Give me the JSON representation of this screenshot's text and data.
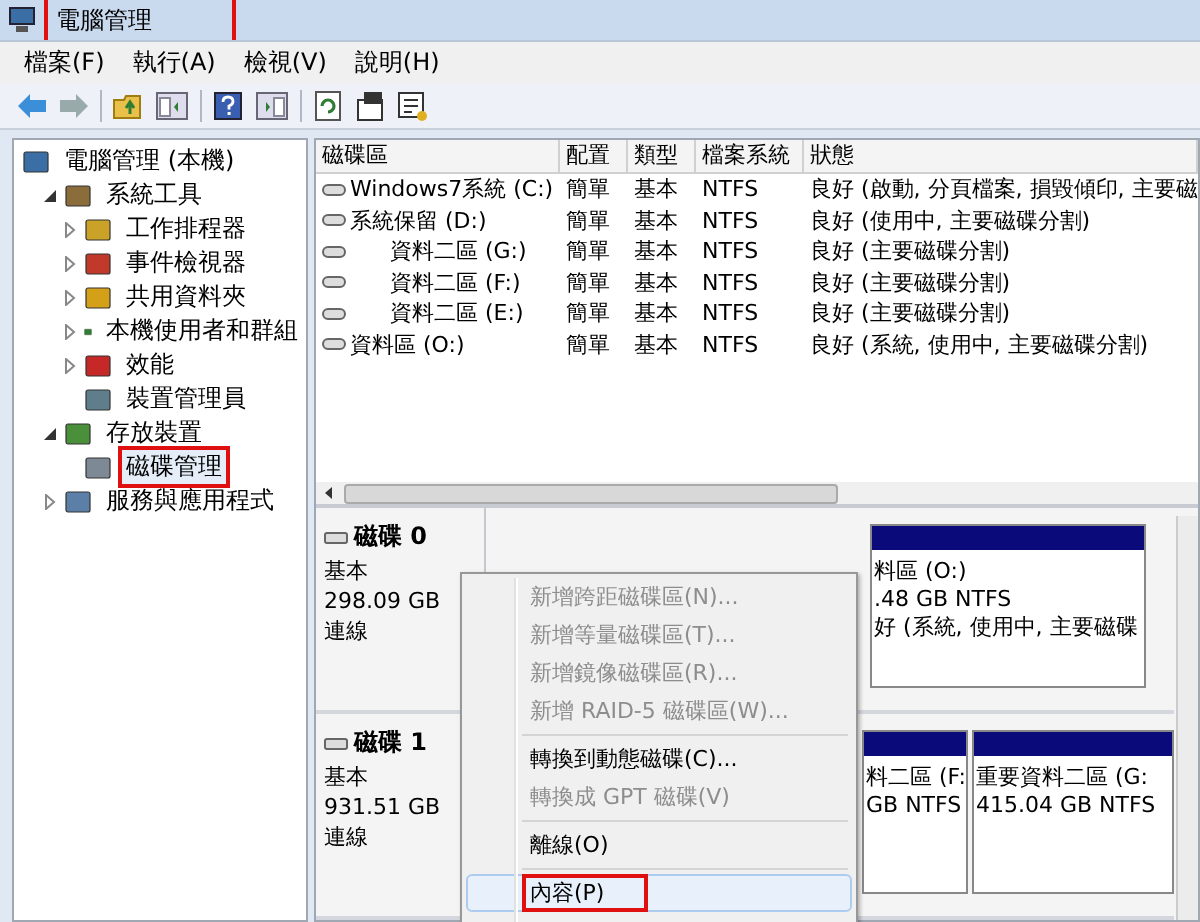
{
  "window": {
    "title": "電腦管理",
    "highlighted": true
  },
  "menu_bar": [
    "檔案(F)",
    "執行(A)",
    "檢視(V)",
    "說明(H)"
  ],
  "tree": [
    {
      "label": "電腦管理 (本機)",
      "highlighted": false,
      "children": [
        {
          "label": "系統工具",
          "expanded": true,
          "highlighted": false,
          "children": [
            {
              "label": "工作排程器",
              "expanded": false,
              "highlighted": false
            },
            {
              "label": "事件檢視器",
              "expanded": false,
              "highlighted": false
            },
            {
              "label": "共用資料夾",
              "expanded": false,
              "highlighted": false
            },
            {
              "label": "本機使用者和群組",
              "expanded": false,
              "highlighted": false
            },
            {
              "label": "效能",
              "expanded": false,
              "highlighted": false
            },
            {
              "label": "裝置管理員",
              "highlighted": false
            }
          ]
        },
        {
          "label": "存放裝置",
          "expanded": true,
          "highlighted": false,
          "children": [
            {
              "label": "磁碟管理",
              "highlighted": true,
              "selected": true
            }
          ]
        },
        {
          "label": "服務與應用程式",
          "expanded": false,
          "highlighted": false
        }
      ]
    }
  ],
  "volume_table": {
    "columns": [
      "磁碟區",
      "配置",
      "類型",
      "檔案系統",
      "狀態"
    ],
    "rows": [
      {
        "kind": "primary",
        "cells": [
          "Windows7系統 (C:)",
          "簡單",
          "基本",
          "NTFS",
          "良好 (啟動, 分頁檔案, 損毀傾印, 主要磁"
        ]
      },
      {
        "kind": "primary",
        "cells": [
          "系統保留 (D:)",
          "簡單",
          "基本",
          "NTFS",
          "良好 (使用中, 主要磁碟分割)"
        ]
      },
      {
        "kind": "logical",
        "cells": [
          "資料二區 (G:)",
          "簡單",
          "基本",
          "NTFS",
          "良好 (主要磁碟分割)"
        ]
      },
      {
        "kind": "logical",
        "cells": [
          "資料二區 (F:)",
          "簡單",
          "基本",
          "NTFS",
          "良好 (主要磁碟分割)"
        ]
      },
      {
        "kind": "logical",
        "cells": [
          "資料二區 (E:)",
          "簡單",
          "基本",
          "NTFS",
          "良好 (主要磁碟分割)"
        ]
      },
      {
        "kind": "primary",
        "cells": [
          "資料區 (O:)",
          "簡單",
          "基本",
          "NTFS",
          "良好 (系統, 使用中, 主要磁碟分割)"
        ]
      }
    ]
  },
  "disks": [
    {
      "name": "磁碟 0",
      "type": "基本",
      "size": "298.09 GB",
      "status": "連線",
      "partitions": [
        {
          "lines": [
            "料區  (O:)",
            ".48 GB NTFS",
            "好 (系統, 使用中, 主要磁碟"
          ]
        }
      ]
    },
    {
      "name": "磁碟 1",
      "type": "基本",
      "size": "931.51 GB",
      "status": "連線",
      "partitions": [
        {
          "lines": [
            "料二區  (F:",
            "GB NTFS"
          ]
        },
        {
          "lines": [
            "重要資料二區  (G:",
            "415.04 GB NTFS"
          ]
        }
      ]
    }
  ],
  "context_menu": [
    {
      "kind": "item",
      "label": "新增跨距磁碟區(N)...",
      "disabled": true,
      "highlighted": false,
      "selected": false
    },
    {
      "kind": "item",
      "label": "新增等量磁碟區(T)...",
      "disabled": true,
      "highlighted": false,
      "selected": false
    },
    {
      "kind": "item",
      "label": "新增鏡像磁碟區(R)...",
      "disabled": true,
      "highlighted": false,
      "selected": false
    },
    {
      "kind": "item",
      "label": "新增 RAID-5 磁碟區(W)...",
      "disabled": true,
      "highlighted": false,
      "selected": false
    },
    {
      "kind": "separator"
    },
    {
      "kind": "item",
      "label": "轉換到動態磁碟(C)...",
      "disabled": false,
      "highlighted": false,
      "selected": false
    },
    {
      "kind": "item",
      "label": "轉換成 GPT 磁碟(V)",
      "disabled": true,
      "highlighted": false,
      "selected": false
    },
    {
      "kind": "separator"
    },
    {
      "kind": "item",
      "label": "離線(O)",
      "disabled": false,
      "highlighted": false,
      "selected": false
    },
    {
      "kind": "separator"
    },
    {
      "kind": "item",
      "label": "內容(P)",
      "disabled": false,
      "highlighted": true,
      "selected": true
    }
  ]
}
